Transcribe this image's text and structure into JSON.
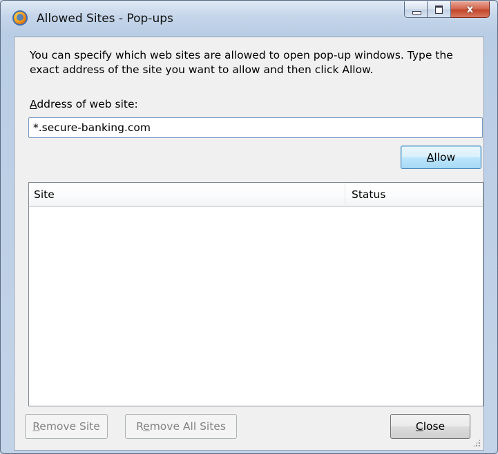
{
  "window": {
    "title": "Allowed Sites - Pop-ups",
    "close_glyph": "x"
  },
  "content": {
    "description": "You can specify which web sites are allowed to open pop-up windows. Type the exact address of the site you want to allow and then click Allow.",
    "address_label_key": "A",
    "address_label_rest": "ddress of web site:",
    "address_value": "*.secure-banking.com"
  },
  "buttons": {
    "allow_key": "A",
    "allow_rest": "llow",
    "remove_site_key": "R",
    "remove_site_rest": "emove Site",
    "remove_all_pre": "R",
    "remove_all_key": "e",
    "remove_all_rest": "move All Sites",
    "close_key": "C",
    "close_rest": "lose"
  },
  "list": {
    "columns": [
      "Site",
      "Status"
    ],
    "rows": []
  },
  "icons": {
    "app": "firefox-icon",
    "minimize": "minimize-icon",
    "maximize": "maximize-icon",
    "close": "close-icon",
    "grip": "resize-grip-icon"
  },
  "colors": {
    "default_button_border": "#3c7fb1",
    "close_button": "#c2462b",
    "frame": "#b9cde5"
  }
}
